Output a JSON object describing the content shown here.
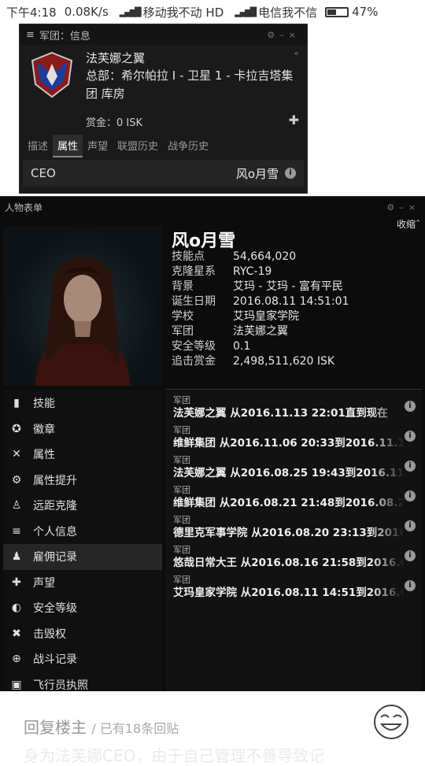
{
  "status_bar": {
    "time": "下午4:18",
    "speed": "0.08K/s",
    "carrier1": "移动我不动 HD",
    "carrier2": "电信我不信",
    "battery": "47%",
    "battery_level": 0.47
  },
  "corp_window": {
    "title": "军团：信息",
    "corp_name": "法芙娜之翼",
    "headquarters": "总部：希尔帕拉 I - 卫星 1 - 卡拉吉塔集团 库房",
    "bounty": "赏金：0 ISK",
    "tabs": [
      "描述",
      "属性",
      "声望",
      "联盟历史",
      "战争历史"
    ],
    "active_tab": 1,
    "ceo_label": "CEO",
    "ceo_name": "风o月雪"
  },
  "character_sheet": {
    "title": "人物表单",
    "collapse_label": "收缩",
    "name": "风o月雪",
    "stats": [
      {
        "label": "技能点",
        "value": "54,664,020"
      },
      {
        "label": "克隆星系",
        "value": "RYC-19"
      },
      {
        "label": "背景",
        "value": "艾玛 - 艾玛 - 富有平民"
      },
      {
        "label": "诞生日期",
        "value": "2016.08.11 14:51:01"
      },
      {
        "label": "学校",
        "value": "艾玛皇家学院"
      },
      {
        "label": "军团",
        "value": "法芙娜之翼"
      },
      {
        "label": "安全等级",
        "value": "0.1"
      },
      {
        "label": "追击赏金",
        "value": "2,498,511,620 ISK"
      }
    ],
    "nav": [
      {
        "label": "技能",
        "icon": "skill-book-icon"
      },
      {
        "label": "徽章",
        "icon": "medal-icon"
      },
      {
        "label": "属性",
        "icon": "dna-icon"
      },
      {
        "label": "属性提升",
        "icon": "implant-icon"
      },
      {
        "label": "远距克隆",
        "icon": "jump-clone-icon"
      },
      {
        "label": "个人信息",
        "icon": "profile-icon"
      },
      {
        "label": "雇佣记录",
        "icon": "employment-icon"
      },
      {
        "label": "声望",
        "icon": "standings-icon"
      },
      {
        "label": "安全等级",
        "icon": "security-icon"
      },
      {
        "label": "击毁权",
        "icon": "kill-rights-icon"
      },
      {
        "label": "战斗记录",
        "icon": "combat-log-icon"
      },
      {
        "label": "飞行员执照",
        "icon": "license-icon"
      }
    ],
    "active_nav": 6,
    "history_label": "军团",
    "history": [
      {
        "text": "法芙娜之翼 从2016.11.13 22:01直到现在"
      },
      {
        "text": "维鲜集团 从2016.11.06 20:33到2016.11.1"
      },
      {
        "text": "法芙娜之翼 从2016.08.25 19:43到2016.11"
      },
      {
        "text": "维鲜集团 从2016.08.21 21:48到2016.08.2"
      },
      {
        "text": "德里克军事学院 从2016.08.20 23:13到2016"
      },
      {
        "text": "悠哉日常大王 从2016.08.16 21:58到2016.0"
      },
      {
        "text": "艾玛皇家学院 从2016.08.11 14:51到2016.0"
      }
    ]
  },
  "reply_bar": {
    "reply_label": "回复楼主",
    "reply_count": "/ 已有18条回贴",
    "ghost_text": "身为法芙娜CEO，由于自己管理不善导致记"
  }
}
